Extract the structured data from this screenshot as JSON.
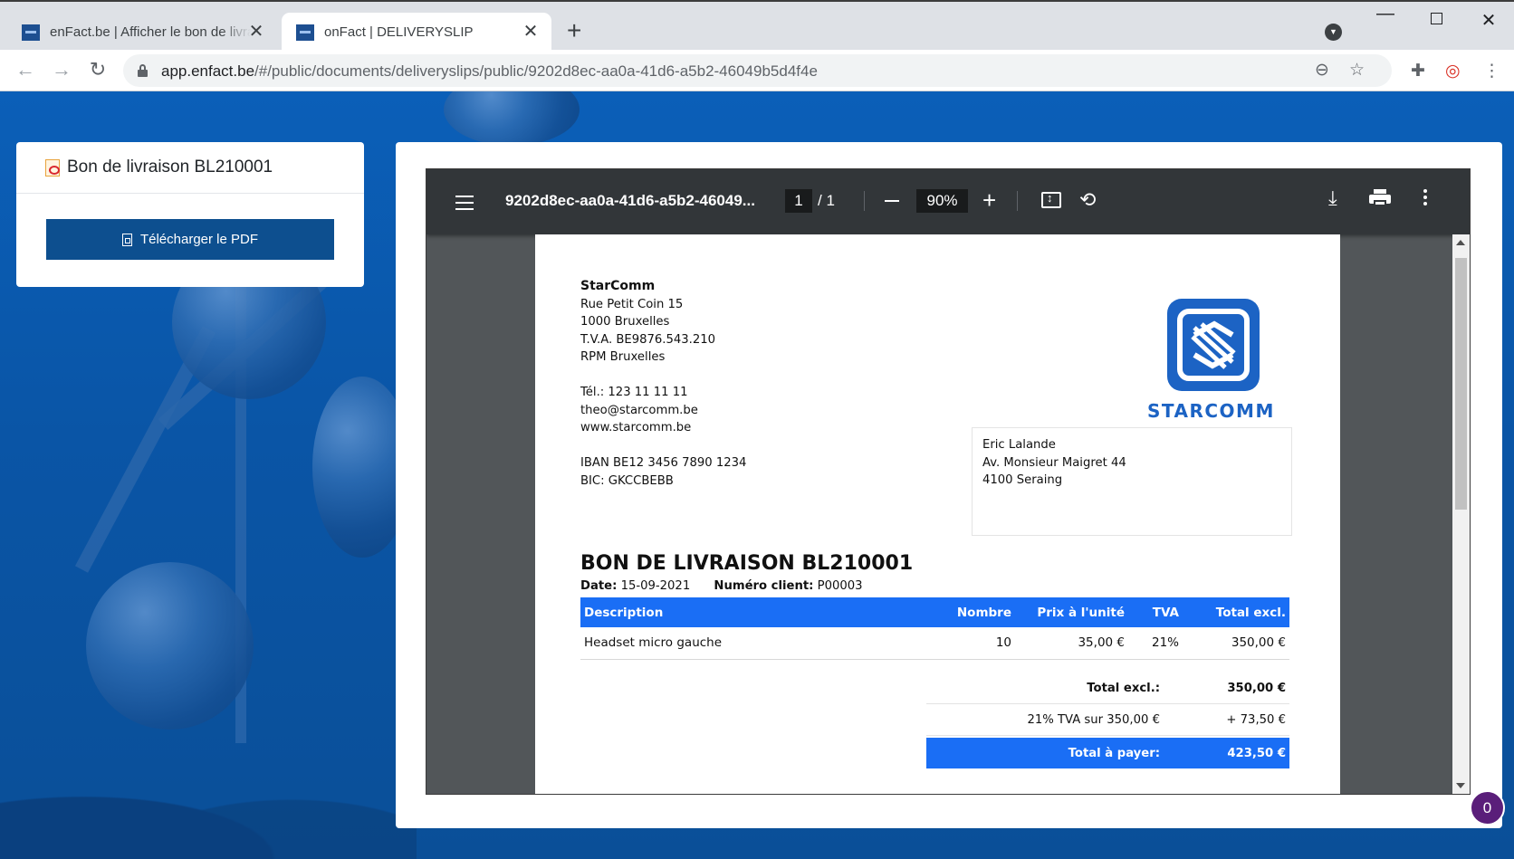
{
  "browser": {
    "tabs": [
      {
        "title": "enFact.be | Afficher le bon de livraison",
        "close": "✕"
      },
      {
        "title": "onFact | DELIVERYSLIP",
        "close": "✕"
      }
    ],
    "new_tab": "+",
    "address": {
      "host": "app.enfact.be",
      "path": "/#/public/documents/deliveryslips/public/9202d8ec-aa0a-41d6-a5b2-46049b5d4f4e"
    }
  },
  "sidebar_card": {
    "title": "Bon de livraison BL210001",
    "download_label": "Télécharger le PDF"
  },
  "viewer": {
    "filename": "9202d8ec-aa0a-41d6-a5b2-46049...",
    "page_current": "1",
    "page_total": "/  1",
    "zoom": "90%"
  },
  "document": {
    "sender": {
      "name": "StarComm",
      "street": "Rue Petit Coin 15",
      "city": "1000 Bruxelles",
      "vat": "T.V.A. BE9876.543.210",
      "rpm": "RPM Bruxelles",
      "phone": "Tél.: 123 11 11 11",
      "email": "theo@starcomm.be",
      "web": "www.starcomm.be",
      "iban": "IBAN BE12 3456 7890 1234",
      "bic": "BIC: GKCCBEBB"
    },
    "logo_text": "STARCOMM",
    "recipient": {
      "name": "Eric Lalande",
      "street": "Av. Monsieur Maigret 44",
      "city": "4100 Seraing"
    },
    "title": "BON DE LIVRAISON BL210001",
    "date_label": "Date:",
    "date_value": "15-09-2021",
    "client_label": "Numéro client:",
    "client_value": "P00003",
    "table": {
      "headers": [
        "Description",
        "Nombre",
        "Prix à l'unité",
        "TVA",
        "Total excl."
      ],
      "rows": [
        {
          "description": "Headset micro gauche",
          "qty": "10",
          "unit_price": "35,00 €",
          "vat": "21%",
          "total": "350,00 €"
        }
      ]
    },
    "totals": {
      "excl_label": "Total excl.:",
      "excl_value": "350,00 €",
      "vat_label": "21% TVA sur 350,00 €",
      "vat_value": "+ 73,50 €",
      "pay_label": "Total à payer:",
      "pay_value": "423,50 €"
    }
  },
  "chat_badge": "0",
  "colors": {
    "page_blue": "#0b5fb8",
    "button_blue": "#0d4f8f",
    "table_blue": "#1a6ef5",
    "logo_blue": "#1c63c4",
    "badge_purple": "#5a1e7a"
  }
}
